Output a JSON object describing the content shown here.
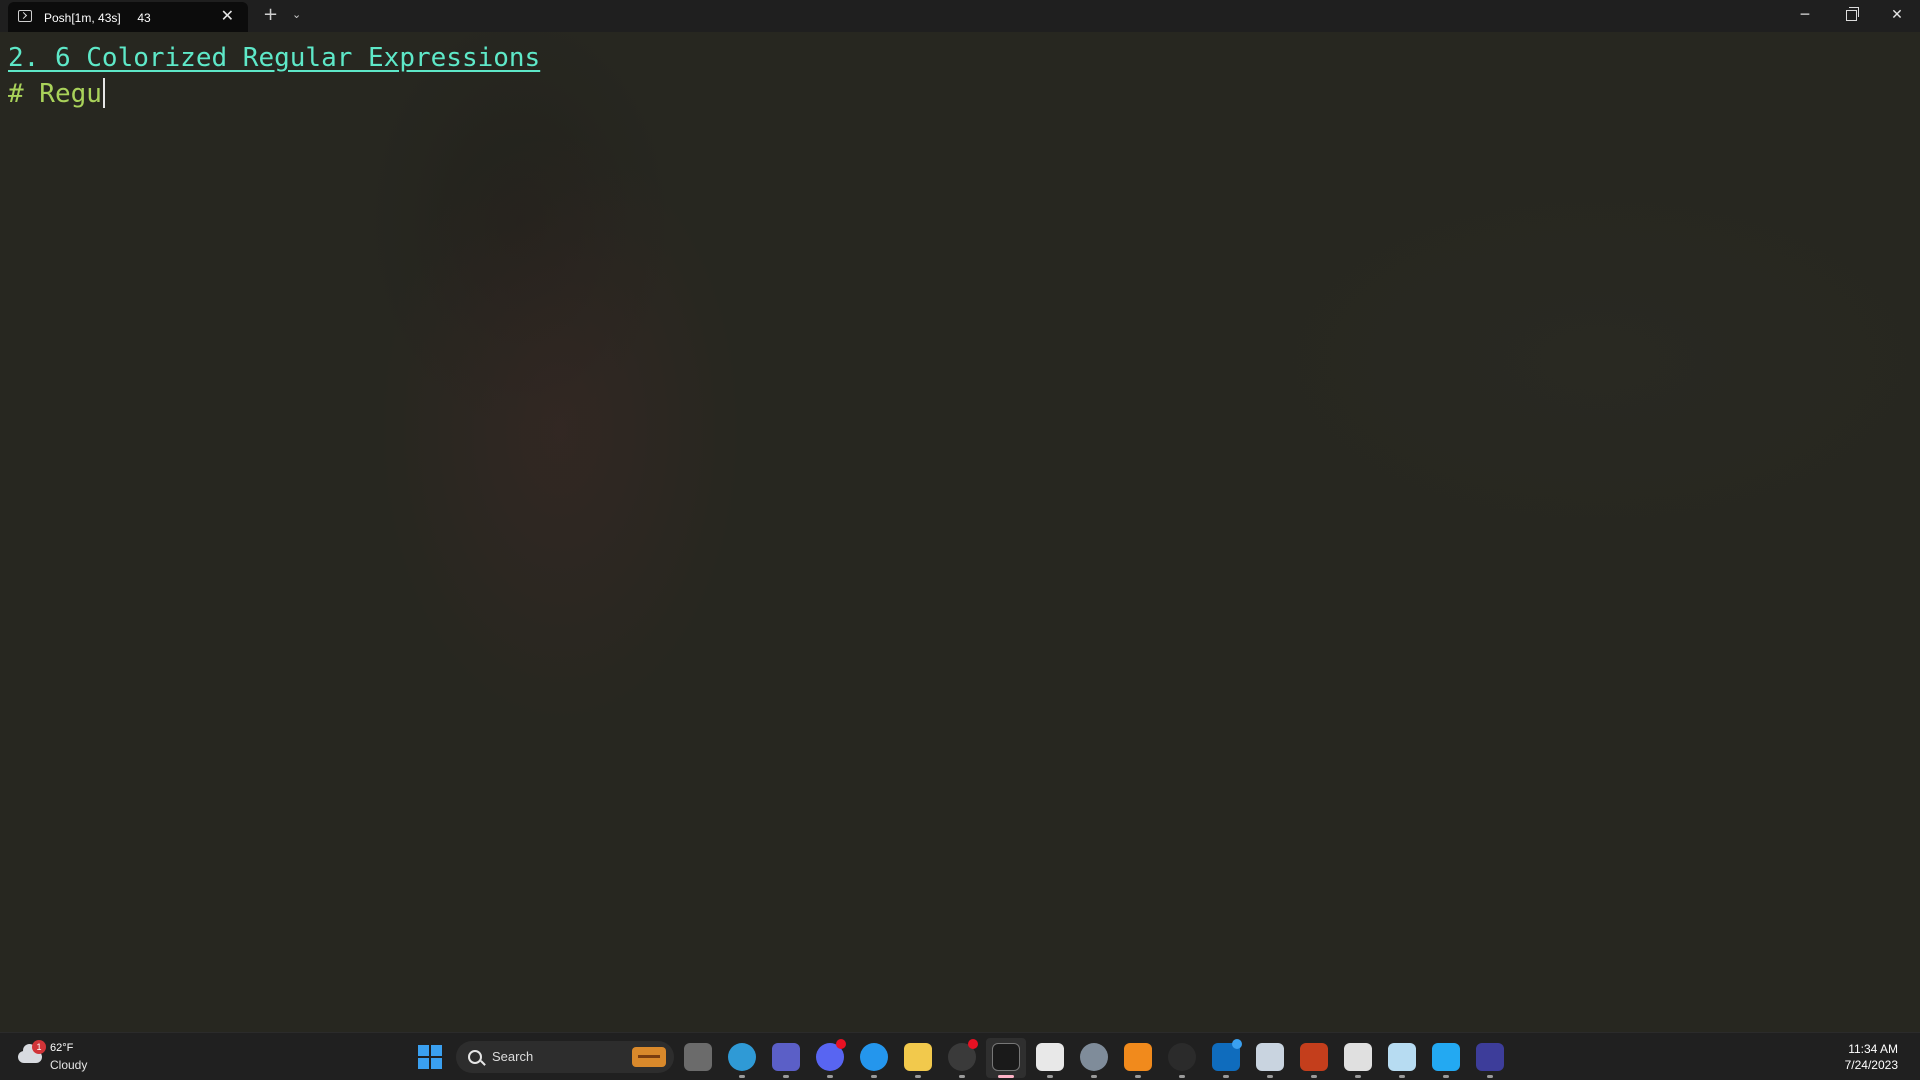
{
  "titlebar": {
    "tab_title": "Posh[1m, 43s]     43",
    "close_glyph": "✕",
    "new_tab_glyph": "+",
    "dropdown_glyph": "⌄",
    "minimize_glyph": "─",
    "close_window_glyph": "✕"
  },
  "terminal": {
    "heading": "2. 6 Colorized Regular Expressions",
    "comment": "# Regu"
  },
  "taskbar": {
    "weather": {
      "badge": "1",
      "temp": "62°F",
      "desc": "Cloudy"
    },
    "search": {
      "label": "Search"
    },
    "apps": [
      {
        "name": "task-view-icon",
        "color": "#6b6b6b"
      },
      {
        "name": "edge-icon",
        "color": "#2f9ad6"
      },
      {
        "name": "teams-icon",
        "color": "#5b5fc7"
      },
      {
        "name": "discord-icon",
        "color": "#5865f2"
      },
      {
        "name": "docker-icon",
        "color": "#2496ed"
      },
      {
        "name": "file-explorer-icon",
        "color": "#f2c94c"
      },
      {
        "name": "obs-icon",
        "color": "#3a3a3a"
      },
      {
        "name": "terminal-icon",
        "color": "#1a1a1a"
      },
      {
        "name": "store-icon",
        "color": "#e8e8e8"
      },
      {
        "name": "settings-icon",
        "color": "#7f8c9a"
      },
      {
        "name": "vlc-icon",
        "color": "#f18a1c"
      },
      {
        "name": "power-icon",
        "color": "#2b2b2b"
      },
      {
        "name": "outlook-icon",
        "color": "#0f6cbd"
      },
      {
        "name": "monitor-icon",
        "color": "#c9d4e0"
      },
      {
        "name": "powerpoint-icon",
        "color": "#c43e1c"
      },
      {
        "name": "calculator-icon",
        "color": "#e0e0e0"
      },
      {
        "name": "photos-icon",
        "color": "#b7dcf2"
      },
      {
        "name": "vscode-icon",
        "color": "#23a9f2"
      },
      {
        "name": "keyboard-icon",
        "color": "#3d3d9a"
      }
    ],
    "clock": {
      "time": "11:34 AM",
      "date": "7/24/2023"
    }
  }
}
